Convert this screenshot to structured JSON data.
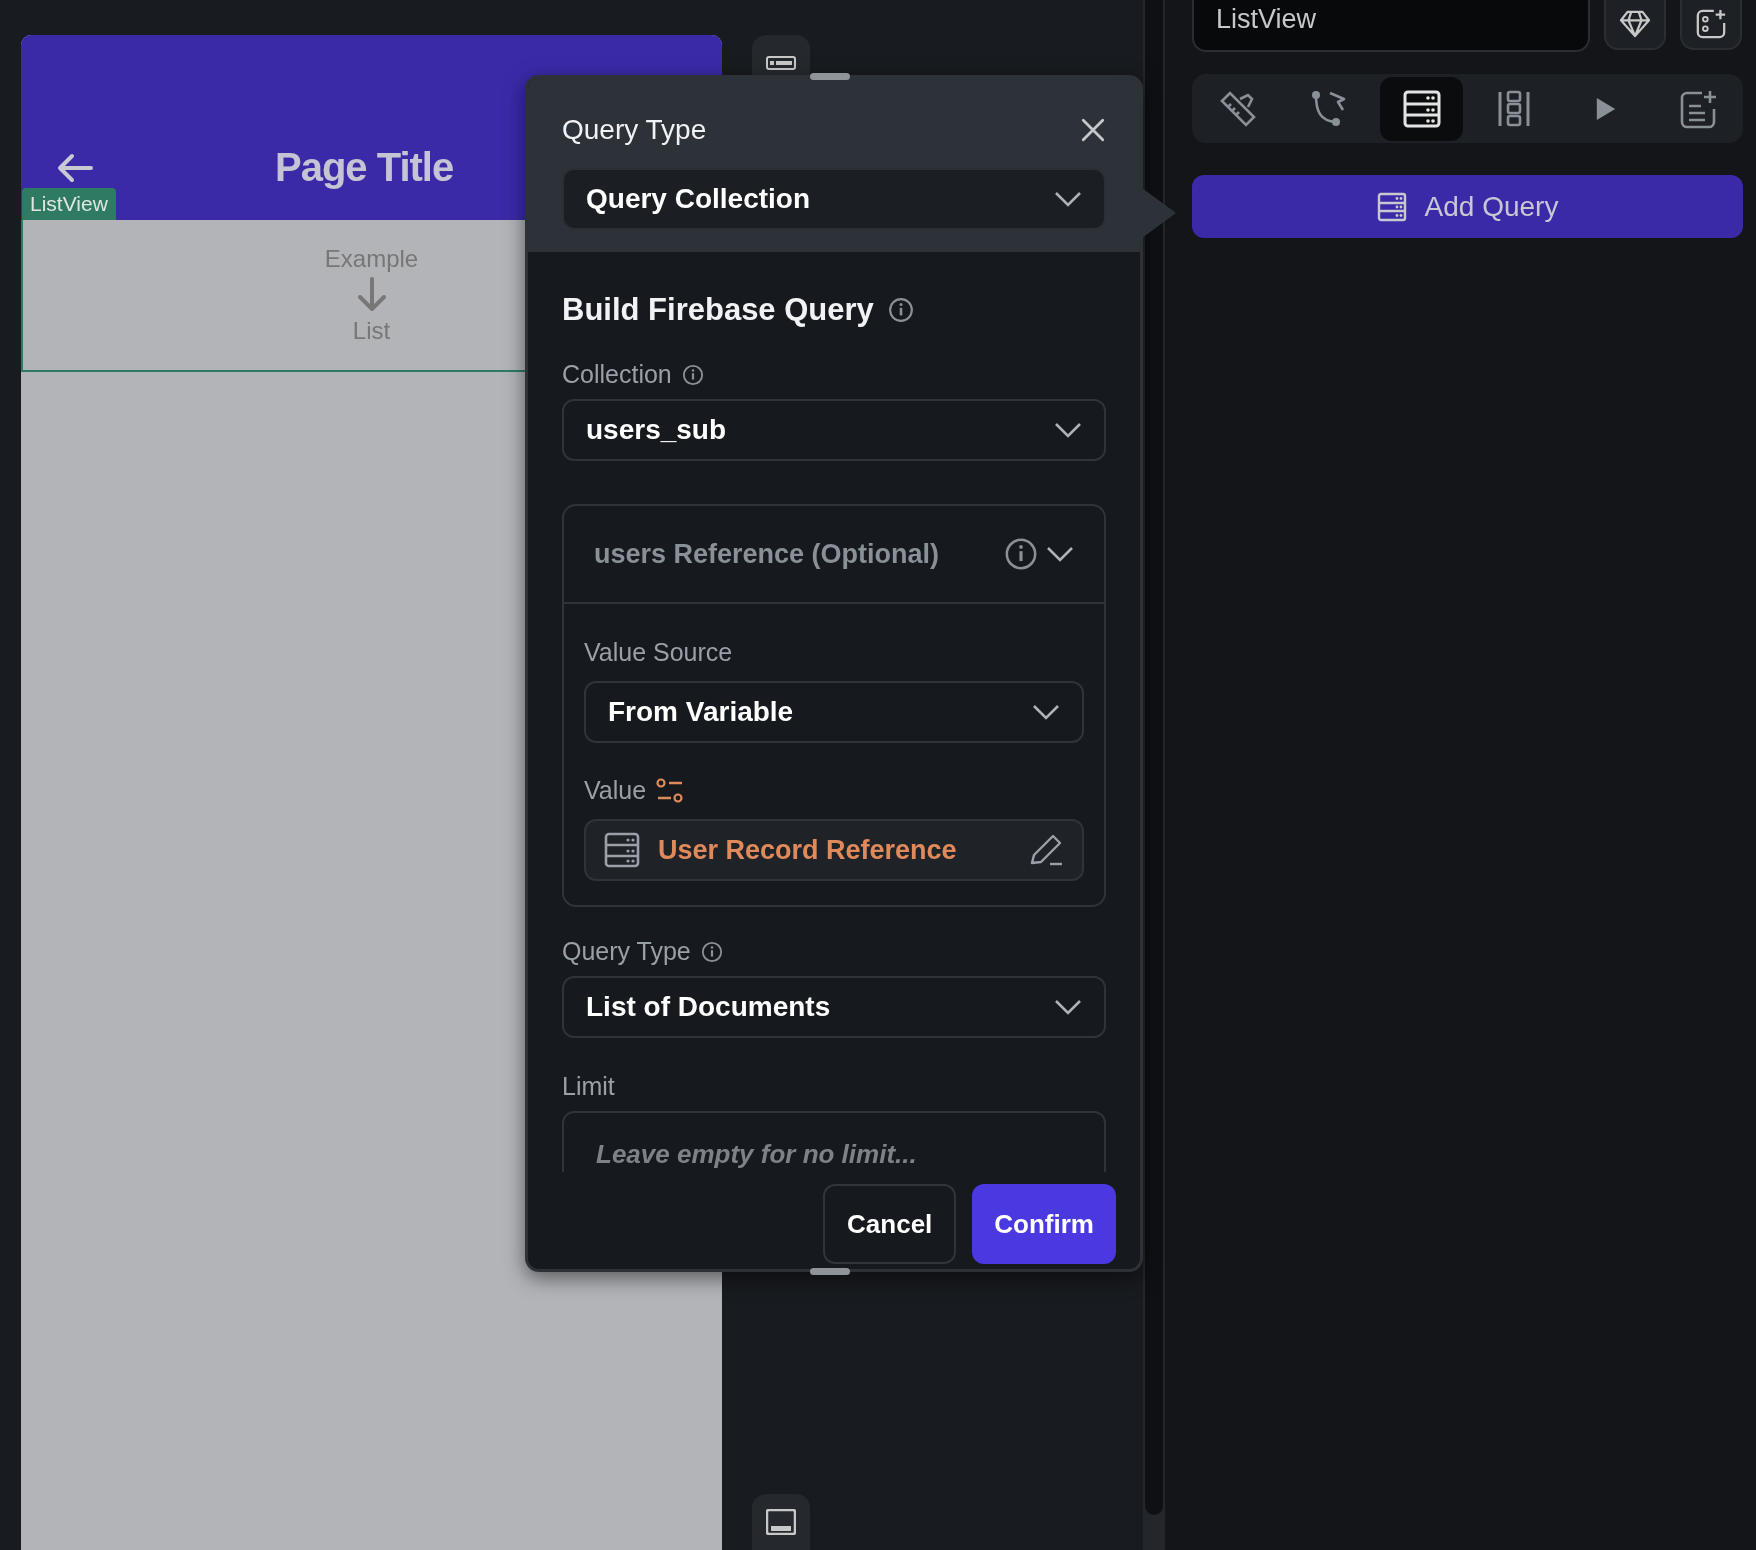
{
  "preview": {
    "page_title": "Page Title",
    "widget_tag": "ListView",
    "list_top": "Example",
    "list_bottom": "List"
  },
  "dialog": {
    "title": "Query Type",
    "query_type": "Query Collection",
    "section_title": "Build Firebase Query",
    "collection": {
      "label": "Collection",
      "value": "users_sub"
    },
    "reference": {
      "title": "users Reference (Optional)",
      "expanded": true,
      "value_source": {
        "label": "Value Source",
        "value": "From Variable"
      },
      "value": {
        "label": "Value",
        "text": "User Record Reference"
      }
    },
    "result_type": {
      "label": "Query Type",
      "value": "List of Documents"
    },
    "limit": {
      "label": "Limit",
      "placeholder": "Leave empty for no limit..."
    },
    "buttons": [
      {
        "label": "Cancel",
        "kind": "secondary"
      },
      {
        "label": "Confirm",
        "kind": "primary"
      }
    ]
  },
  "properties": {
    "widget_name": "ListView",
    "tabs": [
      {
        "selected": false
      },
      {
        "selected": false
      },
      {
        "selected": true
      },
      {
        "selected": false
      },
      {
        "selected": false
      },
      {
        "selected": false
      }
    ],
    "add_query": "Add Query"
  }
}
